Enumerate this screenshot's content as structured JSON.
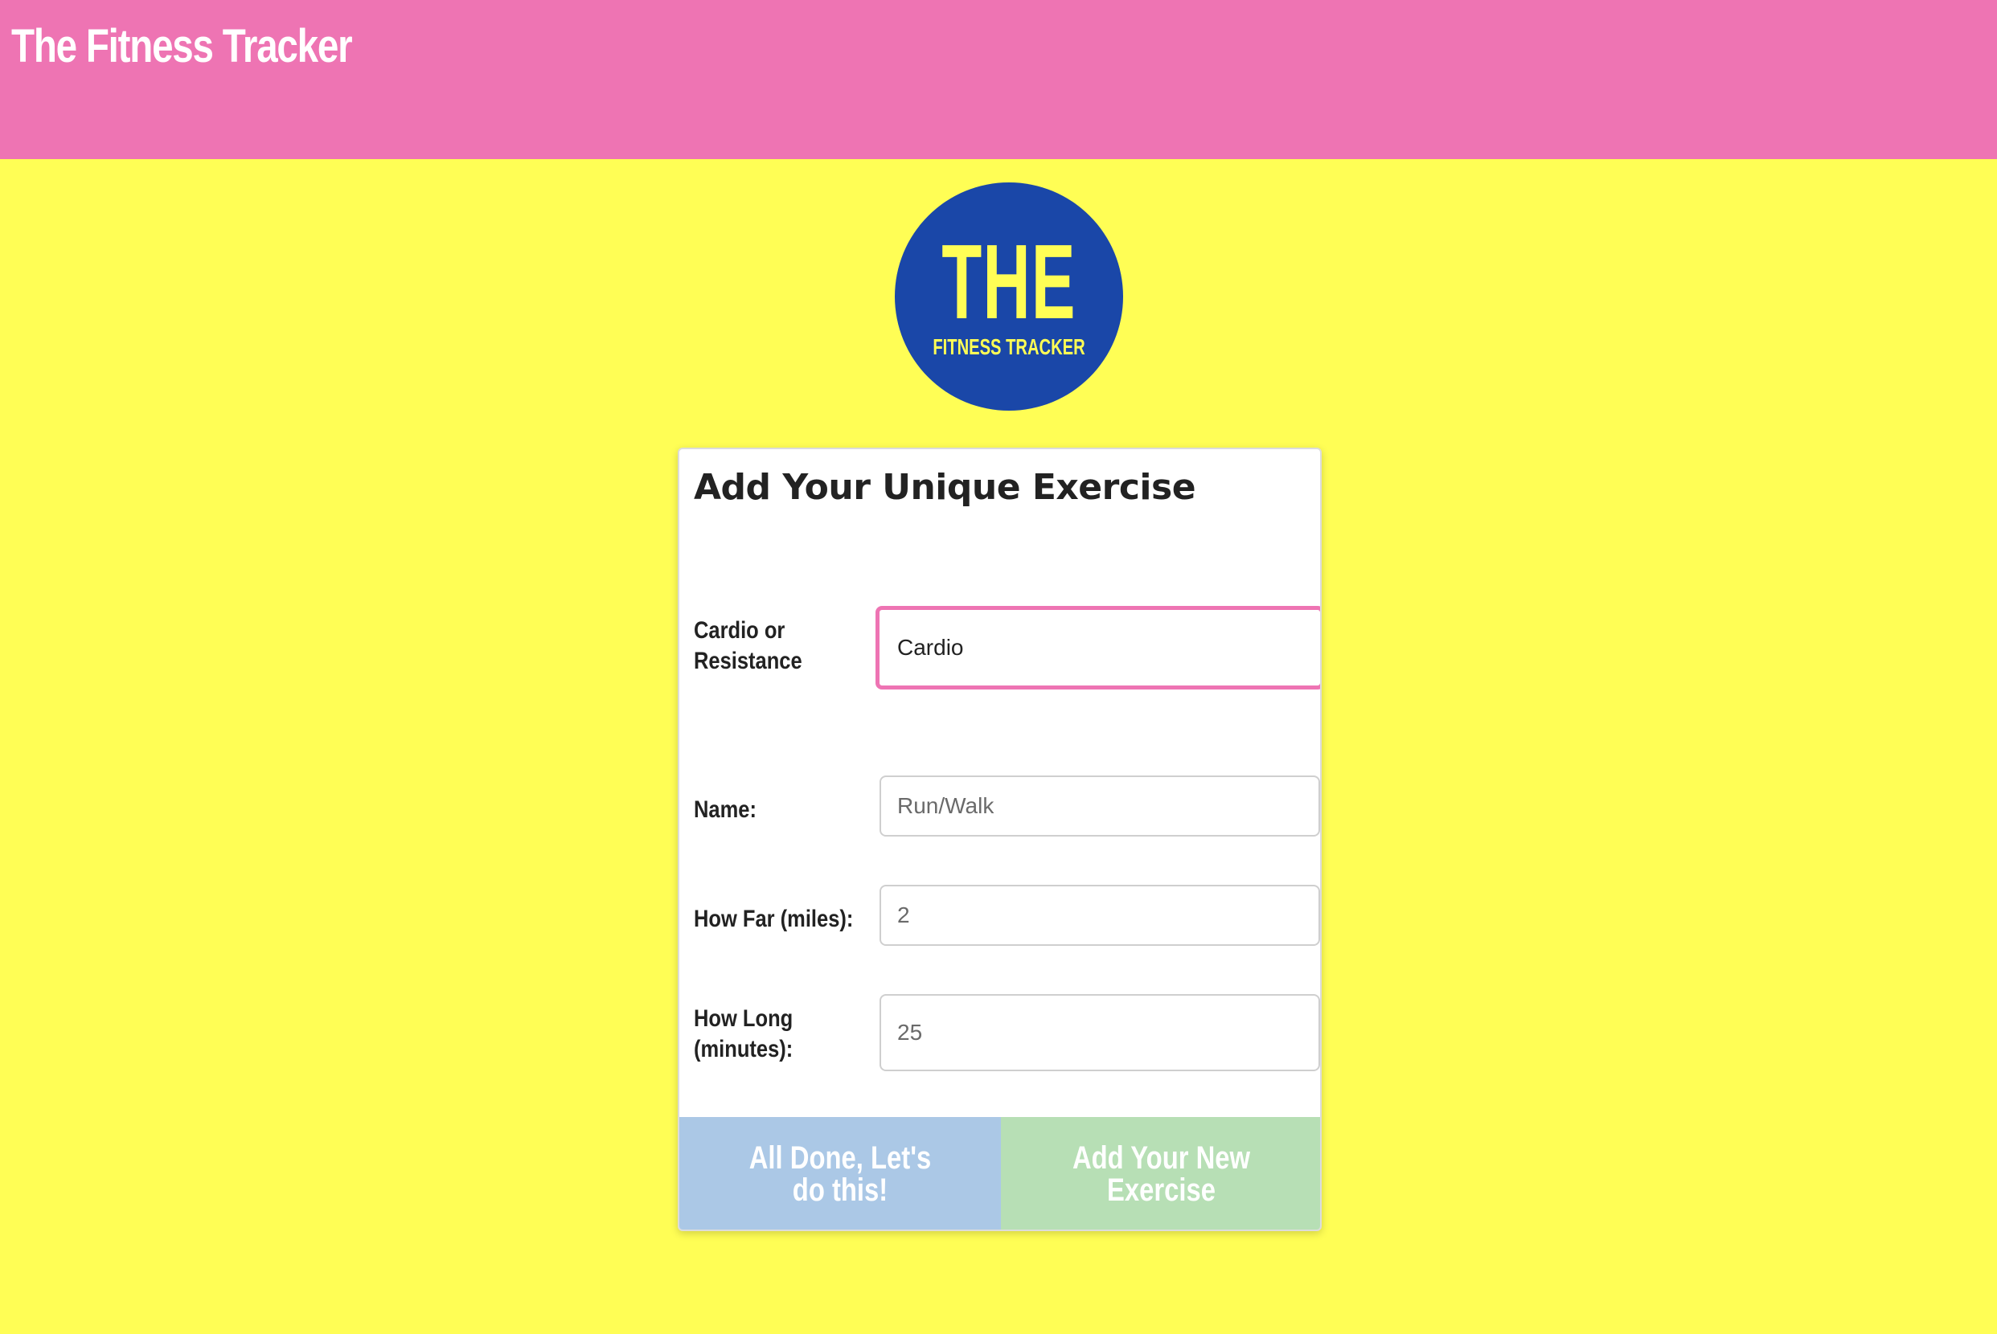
{
  "header": {
    "title": "The Fitness Tracker"
  },
  "logo": {
    "big_text": "THE",
    "small_text": "FITNESS TRACKER"
  },
  "form": {
    "title": "Add Your Unique Exercise",
    "type_label": "Cardio or Resistance",
    "type_value": "Cardio",
    "name_label": "Name:",
    "name_placeholder": "Run/Walk",
    "distance_label": "How Far (miles):",
    "distance_placeholder": "2",
    "duration_label": "How Long (minutes):",
    "duration_placeholder": "25"
  },
  "buttons": {
    "done_label": "All Done, Let's do this!",
    "add_label": "Add Your New Exercise"
  },
  "colors": {
    "header_bg": "#ee74b3",
    "page_bg": "#fffe55",
    "logo_bg": "#1a47a8",
    "done_button_bg": "#abc8e6",
    "add_button_bg": "#b7dfb5"
  }
}
